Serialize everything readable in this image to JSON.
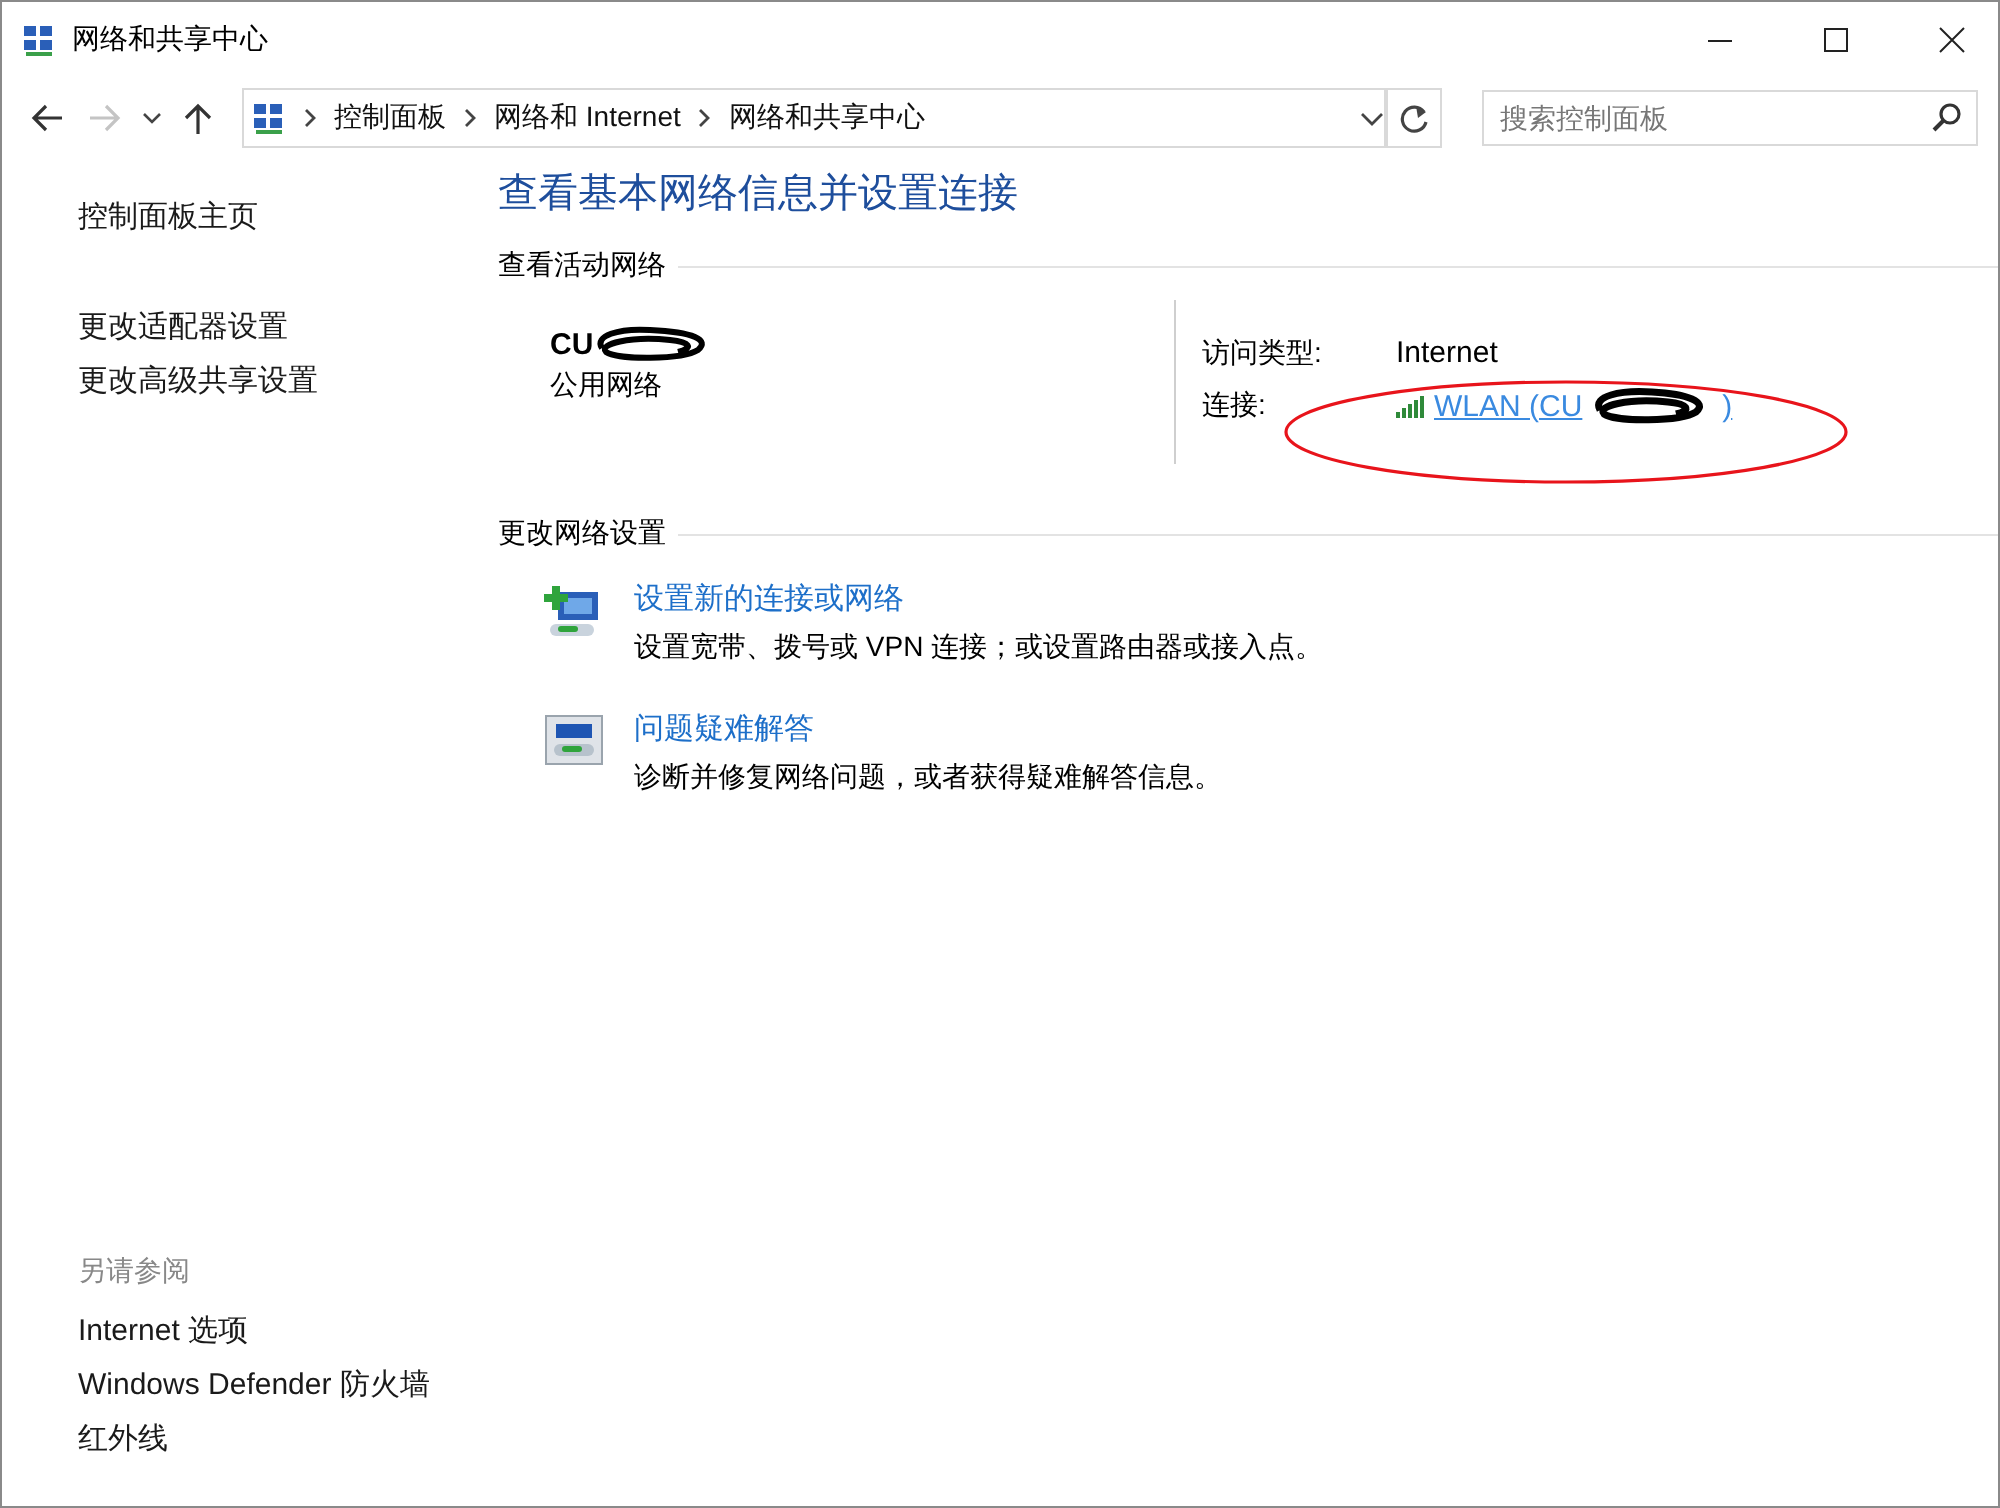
{
  "window": {
    "title": "网络和共享中心"
  },
  "navigation": {
    "back_enabled": true,
    "forward_enabled": false,
    "breadcrumbs": [
      "控制面板",
      "网络和 Internet",
      "网络和共享中心"
    ],
    "search_placeholder": "搜索控制面板"
  },
  "sidebar": {
    "items": [
      "控制面板主页",
      "更改适配器设置",
      "更改高级共享设置"
    ],
    "see_also_title": "另请参阅",
    "see_also": [
      "Internet 选项",
      "Windows Defender 防火墙",
      "红外线"
    ]
  },
  "main": {
    "heading": "查看基本网络信息并设置连接",
    "active_networks_title": "查看活动网络",
    "network": {
      "name": "CU",
      "category": "公用网络",
      "access_label": "访问类型:",
      "access_value": "Internet",
      "connection_label": "连接:",
      "connection_link_start": "WLAN (CU",
      "connection_link_end": ")"
    },
    "change_settings_title": "更改网络设置",
    "tasks": [
      {
        "kind": "setup",
        "title": "设置新的连接或网络",
        "description": "设置宽带、拨号或 VPN 连接；或设置路由器或接入点。"
      },
      {
        "kind": "troubleshoot",
        "title": "问题疑难解答",
        "description": "诊断并修复网络问题，或者获得疑难解答信息。"
      }
    ]
  }
}
